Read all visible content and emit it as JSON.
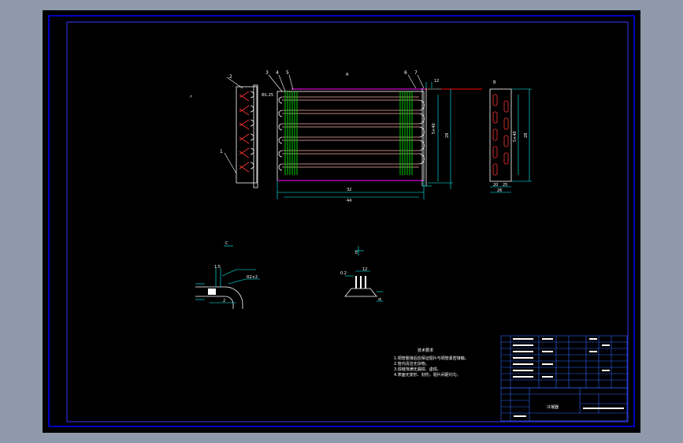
{
  "views": {
    "left_labels": [
      "2",
      "1"
    ],
    "top_labels": [
      "3",
      "4",
      "5",
      "6",
      "7"
    ],
    "tube_label": "Φ1.25",
    "center_label": "A",
    "dim_12": "12",
    "dim_inner": "32",
    "dim_overall": "44",
    "right_label": "B",
    "right_dim_bottom_a": "20",
    "right_dim_bottom_b": "25",
    "right_dim_side": "26",
    "pitch_a": "5×40",
    "pitch_b": "5×40"
  },
  "details": {
    "detail1_title": "C",
    "detail1_dims": [
      "1.5",
      "2",
      "R2×2"
    ],
    "detail2_title": "E",
    "detail2_dims": [
      "12",
      "0.2",
      "6"
    ]
  },
  "notes": {
    "title": "技术要求",
    "lines": [
      "1.铜管胀接后应保证翅片与铜管紧密接触。",
      "2.管内清洁无杂物。",
      "3.焊缝饱满无漏焊、虚焊。",
      "4.表面无变形、划伤，翅片间距均匀。"
    ]
  },
  "title_block": {
    "drawing_name": "冷凝器",
    "rows": 8
  },
  "colors": {
    "frame_border": "#0000ff",
    "line": "#ffffff",
    "fin": "#00cc00",
    "header": "#ff00ff",
    "dimension": "#00ffff",
    "accent": "#ff0000"
  }
}
